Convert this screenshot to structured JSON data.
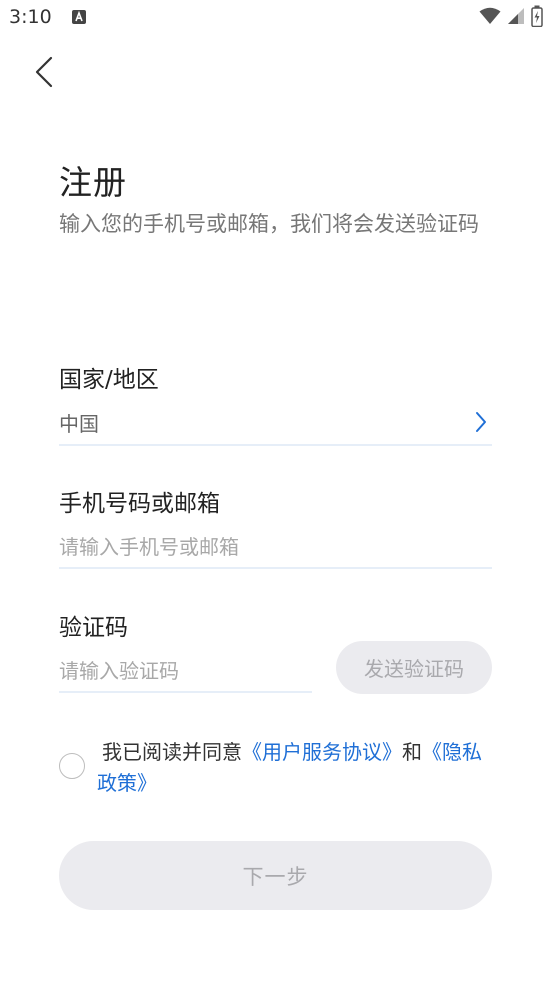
{
  "status_bar": {
    "time": "3:10",
    "notification_icon": "a-icon",
    "icons": [
      "wifi-icon",
      "cellular-signal-icon",
      "battery-charging-icon"
    ]
  },
  "nav": {
    "back_icon": "chevron-left-icon"
  },
  "header": {
    "title": "注册",
    "subtitle": "输入您的手机号或邮箱，我们将会发送验证码"
  },
  "region": {
    "label": "国家/地区",
    "value": "中国",
    "chevron_icon": "chevron-right-icon"
  },
  "account": {
    "label": "手机号码或邮箱",
    "placeholder": "请输入手机号或邮箱",
    "value": ""
  },
  "code": {
    "label": "验证码",
    "placeholder": "请输入验证码",
    "value": "",
    "send_button_label": "发送验证码"
  },
  "agreement": {
    "checked": false,
    "prefix": "我已阅读并同意",
    "user_agreement_link": "《用户服务协议》",
    "conjunction": "和",
    "privacy_link": "《隐私政策》"
  },
  "next_button_label": "下一步",
  "colors": {
    "accent": "#1f6fd6",
    "disabled_button_bg": "#ebebef",
    "disabled_button_text": "#a9a9ad",
    "field_line": "#e6eef8"
  }
}
